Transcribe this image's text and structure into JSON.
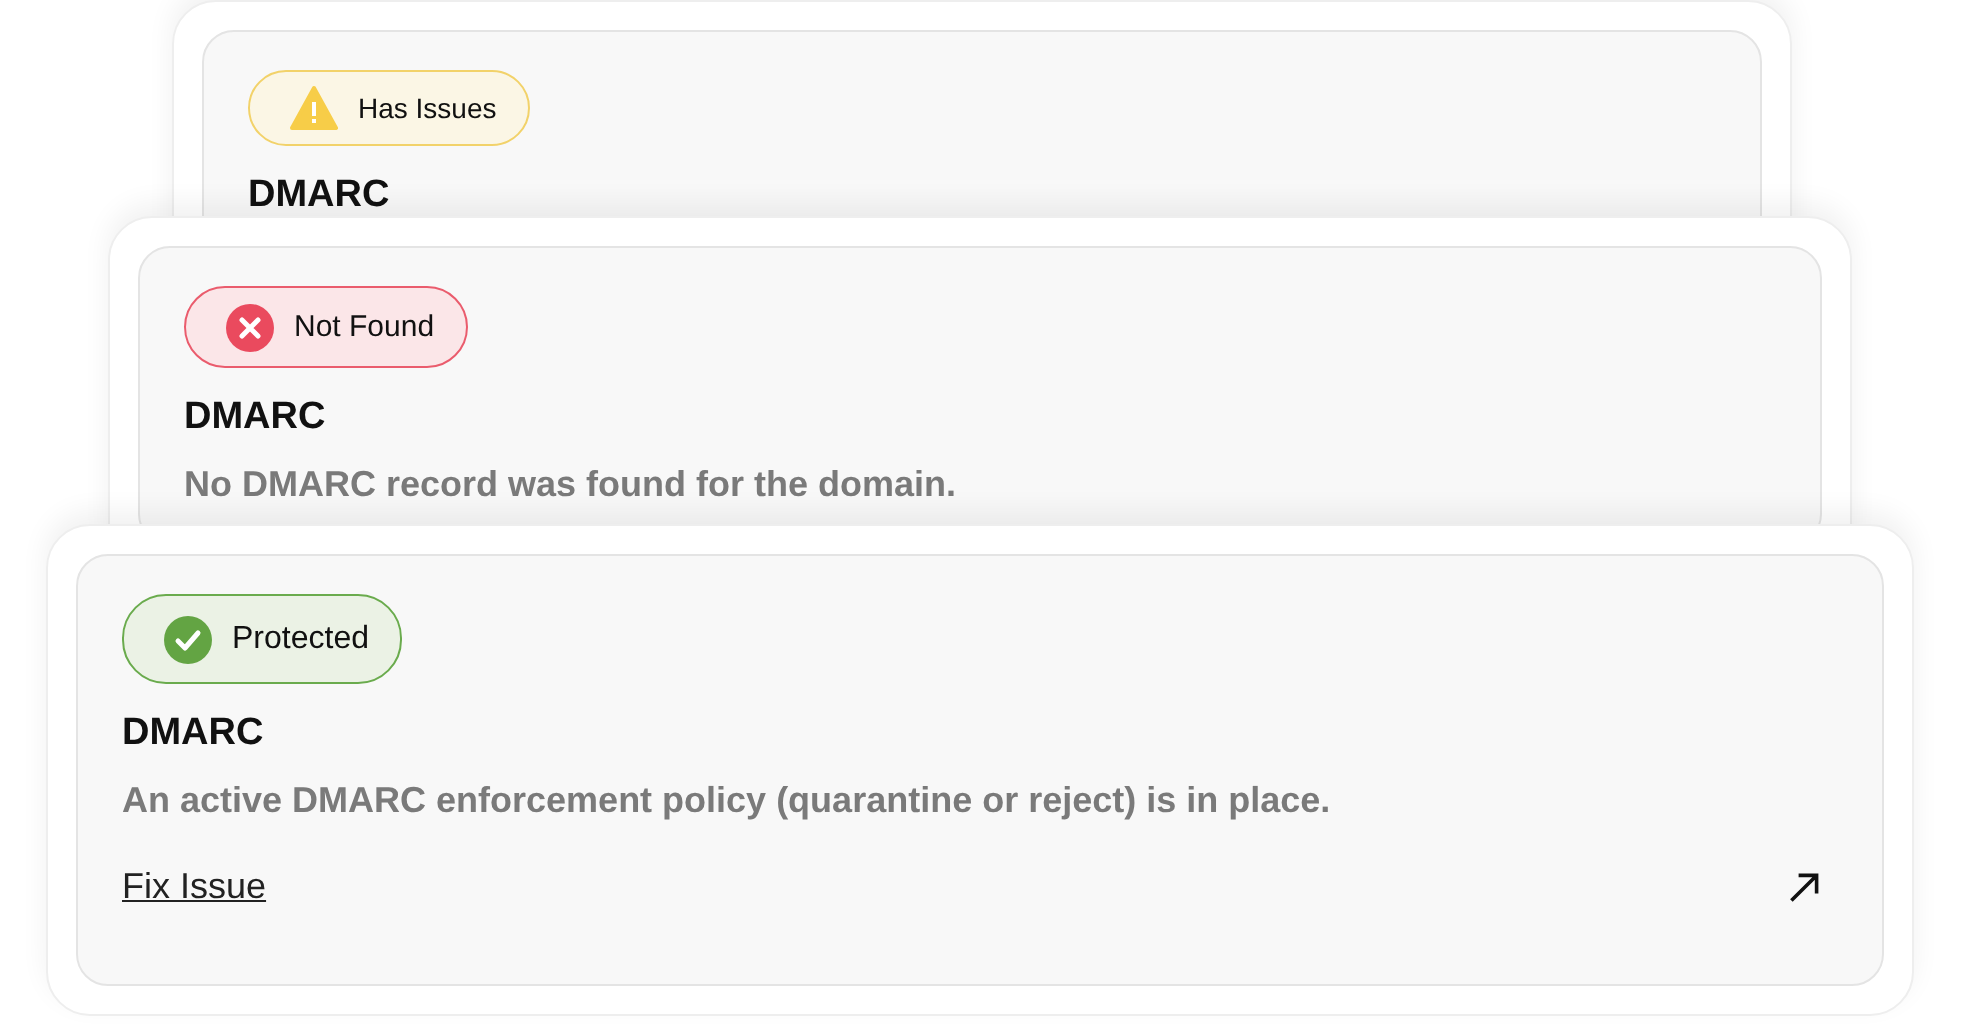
{
  "cards": [
    {
      "kind": "warning",
      "badge": "Has Issues",
      "title": "DMARC"
    },
    {
      "kind": "error",
      "badge": "Not Found",
      "title": "DMARC",
      "description": "No DMARC record was found for the domain."
    },
    {
      "kind": "success",
      "badge": "Protected",
      "title": "DMARC",
      "description": "An active DMARC enforcement policy (quarantine or reject) is in place.",
      "link": "Fix Issue"
    }
  ]
}
